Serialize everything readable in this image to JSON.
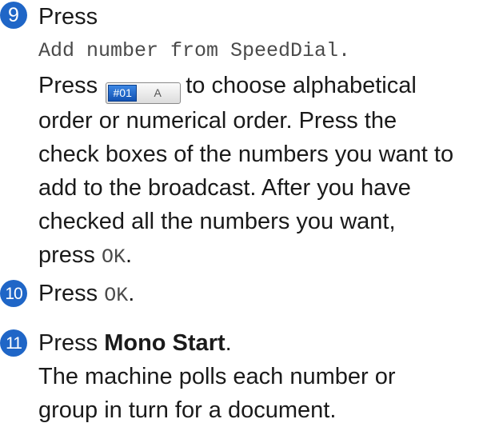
{
  "steps": [
    {
      "number": "9",
      "title": "Press",
      "menu_item": "Add number from SpeedDial.",
      "sentence1_pre": "Press",
      "button": {
        "left_label": "#01",
        "right_label": "A",
        "icon": "speed-dial-sort-toggle-icon"
      },
      "sentence1_post": "to choose alphabetical",
      "body_lines": [
        "order or numerical order. Press the",
        "check boxes of the numbers you want to",
        "add to the broadcast. After you have",
        "checked all the numbers you want,"
      ],
      "final_pre": "press",
      "final_key": "OK",
      "final_post": "."
    },
    {
      "number": "10",
      "pre": "Press",
      "key": "OK",
      "post": "."
    },
    {
      "number": "11",
      "pre": "Press",
      "bold_key": "Mono Start",
      "post": ".",
      "body_lines": [
        "The machine polls each number or",
        "group in turn for a document."
      ]
    }
  ],
  "colors": {
    "badge": "#1f66c7",
    "text": "#1a1a1a",
    "mono_text": "#4a4a4a"
  }
}
